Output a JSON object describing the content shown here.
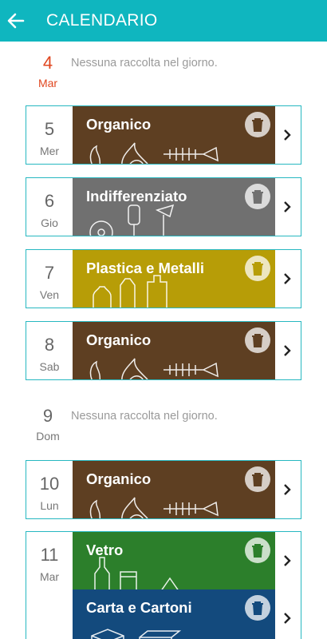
{
  "header": {
    "title": "CALENDARIO"
  },
  "empty_message": "Nessuna raccolta nel giorno.",
  "days": [
    {
      "num": "4",
      "weekday": "Mar"
    },
    {
      "num": "5",
      "weekday": "Mer",
      "collections": [
        "Organico"
      ]
    },
    {
      "num": "6",
      "weekday": "Gio",
      "collections": [
        "Indifferenziato"
      ]
    },
    {
      "num": "7",
      "weekday": "Ven",
      "collections": [
        "Plastica e Metalli"
      ]
    },
    {
      "num": "8",
      "weekday": "Sab",
      "collections": [
        "Organico"
      ]
    },
    {
      "num": "9",
      "weekday": "Dom"
    },
    {
      "num": "10",
      "weekday": "Lun",
      "collections": [
        "Organico"
      ]
    },
    {
      "num": "11",
      "weekday": "Mar",
      "collections": [
        "Vetro",
        "Carta e Cartoni"
      ]
    }
  ],
  "colors": {
    "appbar": "#0fb6bf",
    "border": "#27b8c1",
    "today": "#e0461f",
    "organico": "#5e3f22",
    "indifferenziato": "#707070",
    "plastica": "#b79d07",
    "vetro": "#2c7f2b",
    "carta": "#134a7d"
  },
  "icons": {
    "back": "arrow-left-icon",
    "trash": "trash-icon",
    "chevron": "chevron-right-icon"
  }
}
